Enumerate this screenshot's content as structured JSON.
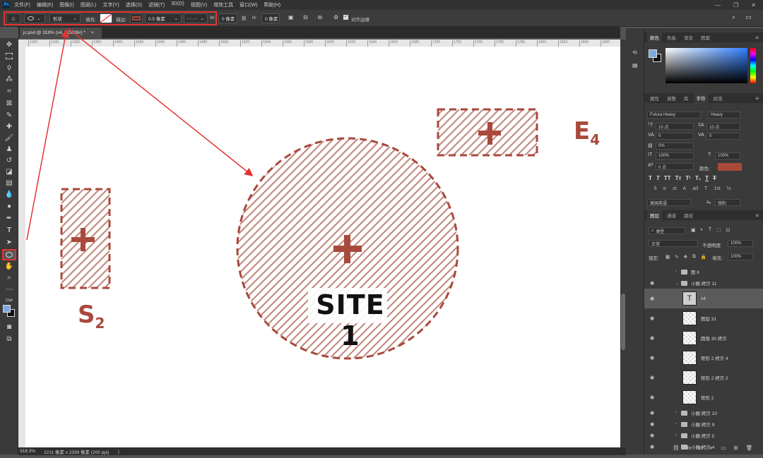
{
  "app": {
    "logo": "Ps"
  },
  "menu": [
    "文件(F)",
    "编辑(E)",
    "图像(I)",
    "图层(L)",
    "文字(Y)",
    "选择(S)",
    "滤镜(T)",
    "3D(D)",
    "视图(V)",
    "增效工具",
    "窗口(W)",
    "帮助(H)"
  ],
  "window_controls": [
    "—",
    "❐",
    "✕"
  ],
  "options": {
    "mode": "形状",
    "fill_label": "填充:",
    "stroke_label": "描边:",
    "stroke_width": "0.5 像素",
    "w_label": "W:",
    "w_value": "0 像素",
    "h_label": "H:",
    "h_value": "0 像素",
    "align_edges": "对齐边缘"
  },
  "document": {
    "tab_title": "jc.psd @ 318% (s4, RGB/8#) *",
    "close": "×"
  },
  "ruler_ticks": [
    "1320",
    "1340",
    "1360",
    "1380",
    "1400",
    "1420",
    "1440",
    "1460",
    "1480",
    "1500",
    "1520",
    "1540",
    "1560",
    "1580",
    "1600",
    "1620",
    "1640",
    "1660",
    "1680",
    "1700",
    "1720",
    "1740",
    "1760",
    "1780",
    "1800",
    "1820",
    "1840",
    "1860"
  ],
  "canvas": {
    "site_label": "SITE 1",
    "s_label": "S",
    "s_sub": "2",
    "e_label": "E",
    "e_sub": "4",
    "accent": "#a9493c"
  },
  "status": {
    "zoom": "318.3%",
    "doc_info": "2211 像素 x 2339 像素 (200 ppi)",
    "arrow": "〉"
  },
  "color_panel": {
    "tabs": [
      "颜色",
      "色板",
      "渐变",
      "图案"
    ],
    "active": 0
  },
  "char_panel": {
    "tabs": [
      "属性",
      "调整",
      "库",
      "字符",
      "段落"
    ],
    "active": 3,
    "font_family": "Futura Heavy",
    "font_style": "Heavy",
    "font_size": "10 点",
    "leading": "10 点",
    "kerning": "0",
    "tracking": "0",
    "tsume": "0%",
    "vscale": "100%",
    "hscale": "100%",
    "baseline": "0 点",
    "color_label": "颜色:",
    "color": "#a9493c",
    "language": "美国英语",
    "aa": "锐利",
    "aa_prefix": "aₐ"
  },
  "layers_panel": {
    "tabs": [
      "图层",
      "通道",
      "路径"
    ],
    "active": 0,
    "filter": "类型",
    "blend": "正常",
    "opacity_label": "不透明度:",
    "opacity": "100%",
    "lock_label": "锁定:",
    "fill_label": "填充:",
    "fill": "100%",
    "layers": [
      {
        "name": "图 8",
        "type": "group",
        "visible": false,
        "selected": false
      },
      {
        "name": "小圈 拷贝 11",
        "type": "group-open",
        "visible": true,
        "selected": false
      },
      {
        "name": "s4",
        "type": "text",
        "visible": true,
        "selected": true
      },
      {
        "name": "图层 31",
        "type": "pixel",
        "visible": true,
        "selected": false
      },
      {
        "name": "圆角 30 拷贝",
        "type": "pixel",
        "visible": true,
        "selected": false
      },
      {
        "name": "矩形 2 拷贝 4",
        "type": "pixel",
        "visible": true,
        "selected": false
      },
      {
        "name": "矩形 2 拷贝 2",
        "type": "pixel",
        "visible": true,
        "selected": false
      },
      {
        "name": "矩形 2",
        "type": "pixel",
        "visible": true,
        "selected": false
      },
      {
        "name": "小圈 拷贝 10",
        "type": "group",
        "visible": true,
        "selected": false
      },
      {
        "name": "小圈 拷贝 9",
        "type": "group",
        "visible": true,
        "selected": false
      },
      {
        "name": "小圈 拷贝 5",
        "type": "group",
        "visible": true,
        "selected": false
      },
      {
        "name": "小圈 拷贝 4",
        "type": "group",
        "visible": true,
        "selected": false
      }
    ],
    "footer_icons": [
      "link-icon",
      "fx-icon",
      "mask-icon",
      "adjustment-icon",
      "folder-icon",
      "new-layer-icon",
      "trash-icon"
    ],
    "footer_glyphs": [
      "⛓",
      "fx",
      "◘",
      "◐",
      "▭",
      "⊞",
      "🗑"
    ]
  }
}
